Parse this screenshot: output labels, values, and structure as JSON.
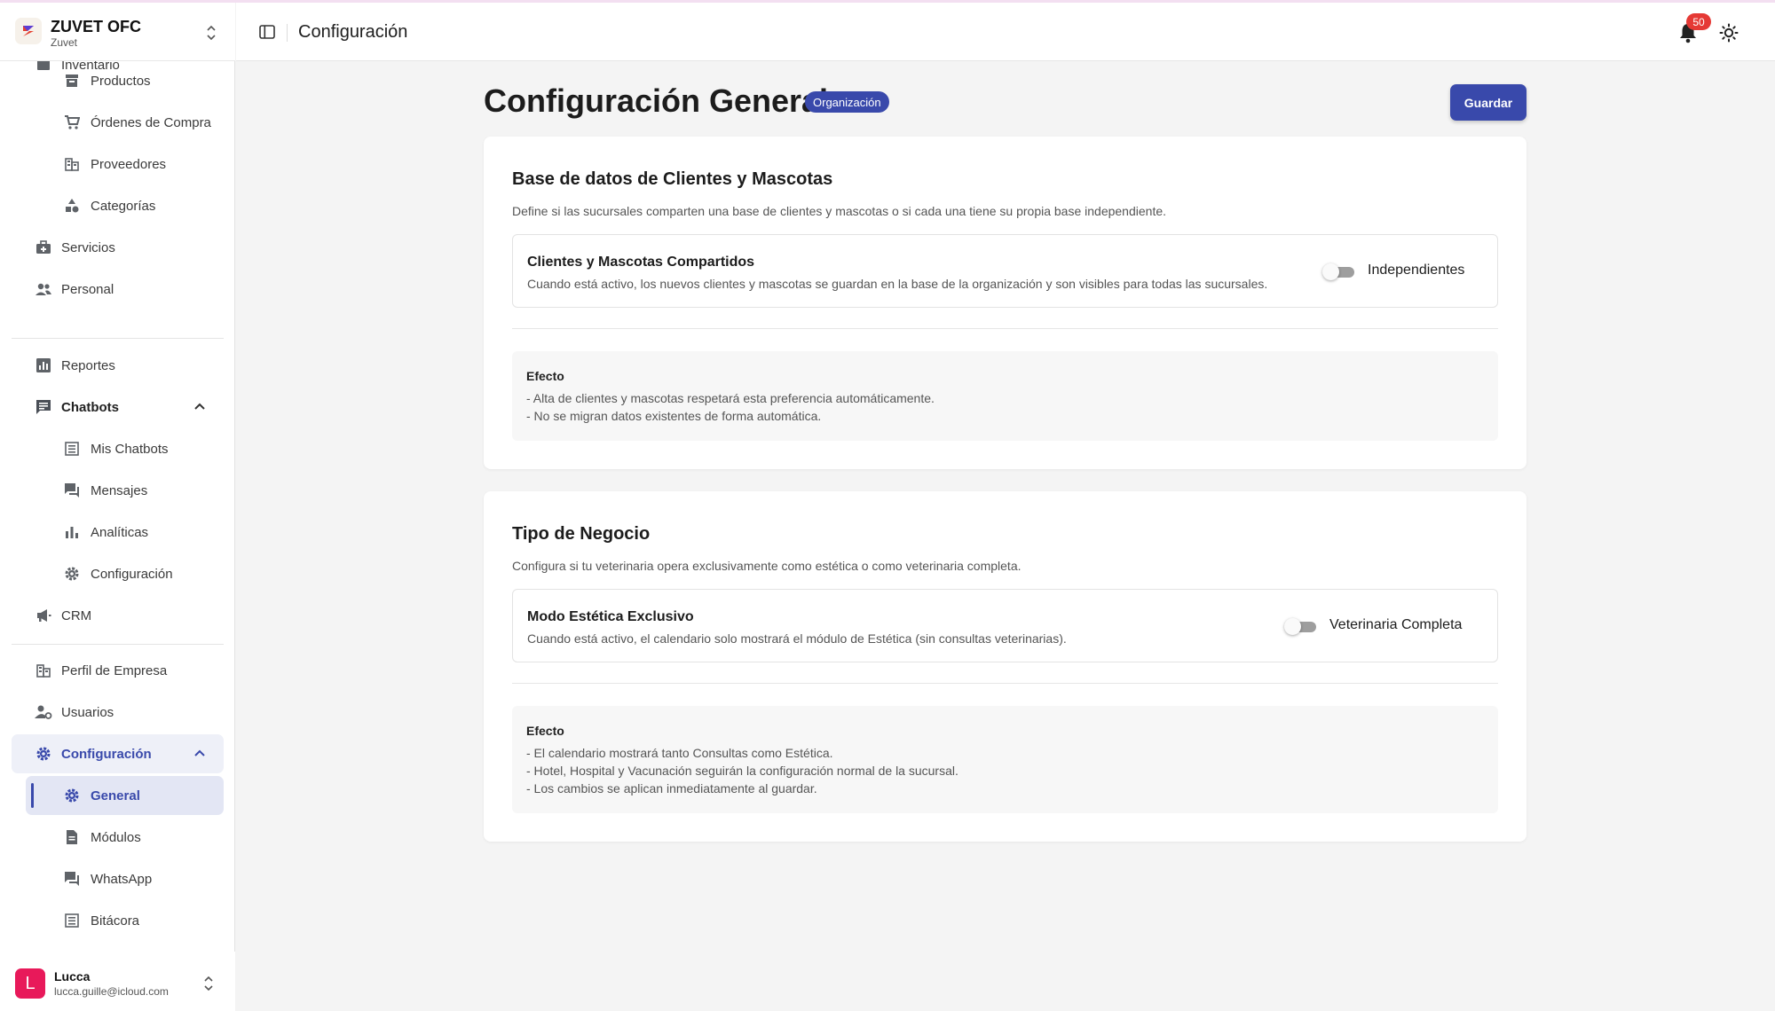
{
  "org": {
    "name": "ZUVET OFC",
    "sub": "Zuvet"
  },
  "topbar": {
    "title": "Configuración",
    "notifications": "50"
  },
  "sidebar": {
    "partial_item": "Inventario",
    "items": [
      {
        "label": "Productos"
      },
      {
        "label": "Órdenes de Compra"
      },
      {
        "label": "Proveedores"
      },
      {
        "label": "Categorías"
      },
      {
        "label": "Servicios"
      },
      {
        "label": "Personal"
      },
      {
        "label": "Reportes"
      },
      {
        "label": "Chatbots"
      },
      {
        "label": "Mis Chatbots"
      },
      {
        "label": "Mensajes"
      },
      {
        "label": "Analíticas"
      },
      {
        "label": "Configuración"
      },
      {
        "label": "CRM"
      },
      {
        "label": "Perfil de Empresa"
      },
      {
        "label": "Usuarios"
      },
      {
        "label": "Configuración"
      },
      {
        "label": "General"
      },
      {
        "label": "Módulos"
      },
      {
        "label": "WhatsApp"
      },
      {
        "label": "Bitácora"
      }
    ]
  },
  "user": {
    "initial": "L",
    "name": "Lucca",
    "email": "lucca.guille@icloud.com"
  },
  "page": {
    "title": "Configuración General",
    "badge": "Organización",
    "save_label": "Guardar"
  },
  "cards": [
    {
      "title": "Base de datos de Clientes y Mascotas",
      "description": "Define si las sucursales comparten una base de clientes y mascotas o si cada una tiene su propia base independiente.",
      "setting_title": "Clientes y Mascotas Compartidos",
      "setting_description": "Cuando está activo, los nuevos clientes y mascotas se guardan en la base de la organización y son visibles para todas las sucursales.",
      "toggle_label": "Independientes",
      "toggle_on": false,
      "effect_title": "Efecto",
      "effects": [
        "- Alta de clientes y mascotas respetará esta preferencia automáticamente.",
        "- No se migran datos existentes de forma automática."
      ]
    },
    {
      "title": "Tipo de Negocio",
      "description": "Configura si tu veterinaria opera exclusivamente como estética o como veterinaria completa.",
      "setting_title": "Modo Estética Exclusivo",
      "setting_description": "Cuando está activo, el calendario solo mostrará el módulo de Estética (sin consultas veterinarias).",
      "toggle_label": "Veterinaria Completa",
      "toggle_on": false,
      "effect_title": "Efecto",
      "effects": [
        "- El calendario mostrará tanto Consultas como Estética.",
        "- Hotel, Hospital y Vacunación seguirán la configuración normal de la sucursal.",
        "- Los cambios se aplican inmediatamente al guardar."
      ]
    }
  ],
  "colors": {
    "accent": "#3949ab",
    "badge_red": "#e53935",
    "avatar": "#e8195a"
  },
  "icons": [
    "box-icon",
    "cart-icon",
    "building-icon",
    "shapes-icon",
    "briefcase-icon",
    "people-icon",
    "bar-chart-icon",
    "chat-icon",
    "list-icon",
    "forum-icon",
    "analytics-icon",
    "gear-icon",
    "megaphone-icon",
    "user-gear-icon",
    "document-icon",
    "bell-icon",
    "sun-icon"
  ]
}
